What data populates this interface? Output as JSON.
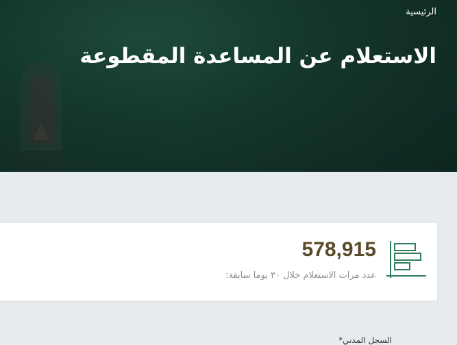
{
  "header": {
    "breadcrumb": "الرئيسية",
    "title": "الاستعلام عن المساعدة المقطوعة"
  },
  "stats": {
    "value": "578,915",
    "label": "عدد مرات الاستعلام خلال ٣٠ يوما سابقة:",
    "icon": "bar-chart-icon"
  },
  "form": {
    "first_field_label": "السجل المدني",
    "required_mark": "*"
  },
  "colors": {
    "hero_bg": "#15382e",
    "page_bg": "#e7ebee",
    "accent_green": "#2e7d5b",
    "stat_value": "#5b4a2a",
    "muted_text": "#8a8f95"
  }
}
